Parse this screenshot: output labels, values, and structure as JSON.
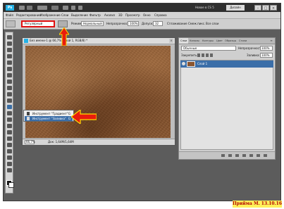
{
  "app": {
    "logo": "Ps",
    "workspace_name": "Новое в CS 5",
    "workspace_button": "Дизайн",
    "window_buttons": [
      "–",
      "□",
      "×"
    ]
  },
  "menu": {
    "items": [
      "Файл",
      "Редактирование",
      "Изображение",
      "Слои",
      "Выделение",
      "Фильтр",
      "Анализ",
      "3D",
      "Просмотр",
      "Окно",
      "Справка"
    ]
  },
  "options": {
    "gradient_type": "Регулярный",
    "mode_label": "Режим:",
    "mode_value": "Нормальный",
    "opacity_label": "Непрозрачность:",
    "opacity_value": "100%",
    "dither_label": "Допуск:",
    "dither_value": "32",
    "antialias_label": "Сглаживание",
    "adjacent_label": "Смеж.пикс.",
    "all_layers_label": "Все слои"
  },
  "document": {
    "title": "Без имени-1 @ 66,7% (Слой 1, RGB/8) *",
    "close": "×",
    "zoom": "66,7%",
    "info": "Док: 1,64M/1,64M"
  },
  "flyout": {
    "items": [
      {
        "label": "Инструмент \"Градиент\"",
        "key": "G"
      },
      {
        "label": "Инструмент \"Заливка\"",
        "key": "G"
      }
    ]
  },
  "layers_panel": {
    "tabs": [
      "Слои",
      "Каналы",
      "Контуры",
      "Цвет",
      "Образцы",
      "Стили"
    ],
    "menu": "≡",
    "blend_mode": "Обычные",
    "opacity_label": "Непрозрачность:",
    "opacity_value": "100%",
    "lock_label": "Закрепить:",
    "fill_label": "Заливка:",
    "fill_value": "100%",
    "layers": [
      {
        "name": "Слой 1"
      }
    ]
  },
  "caption": "Прийма М. 13.10.16"
}
